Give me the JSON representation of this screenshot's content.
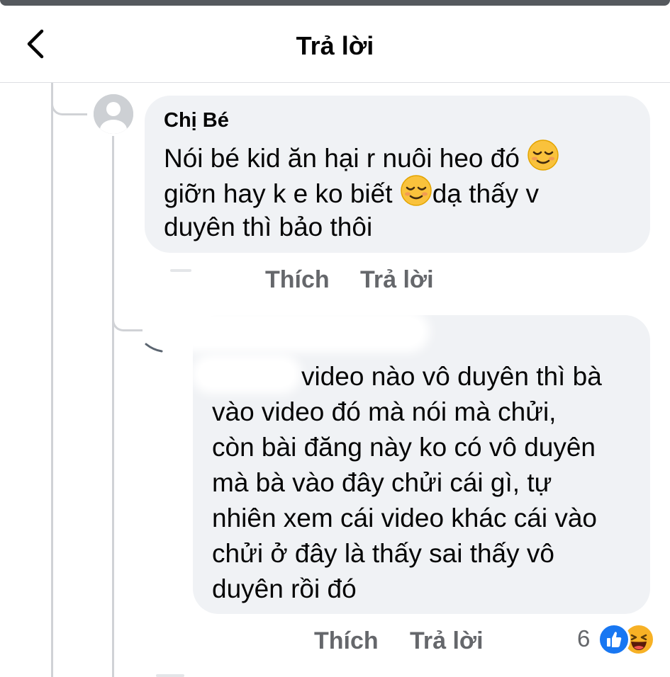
{
  "header": {
    "title": "Trả lời"
  },
  "comments": [
    {
      "author": "Chị Bé",
      "lines": [
        "Nói bé kid ăn hại r nuôi heo đó",
        "giỡn hay k e ko biết",
        "dạ thấy v",
        "duyên thì bảo thôi"
      ],
      "like_label": "Thích",
      "reply_label": "Trả lời"
    },
    {
      "lines": [
        "video nào vô duyên thì bà",
        "vào video đó mà nói mà chửi,",
        "còn bài đăng này ko có vô duyên",
        "mà bà vào đây chửi cái gì, tự",
        "nhiên xem cái video khác cái vào",
        "chửi ở đây là thấy sai thấy vô",
        "duyên rồi đó"
      ],
      "like_label": "Thích",
      "reply_label": "Trả lời",
      "reaction_count": "6",
      "reactions": [
        "like-icon",
        "haha-icon"
      ]
    }
  ],
  "colors": {
    "bubble": "#f0f2f5",
    "text": "#050505",
    "muted": "#65676b",
    "like": "#1877f2",
    "haha": "#f7b125"
  }
}
